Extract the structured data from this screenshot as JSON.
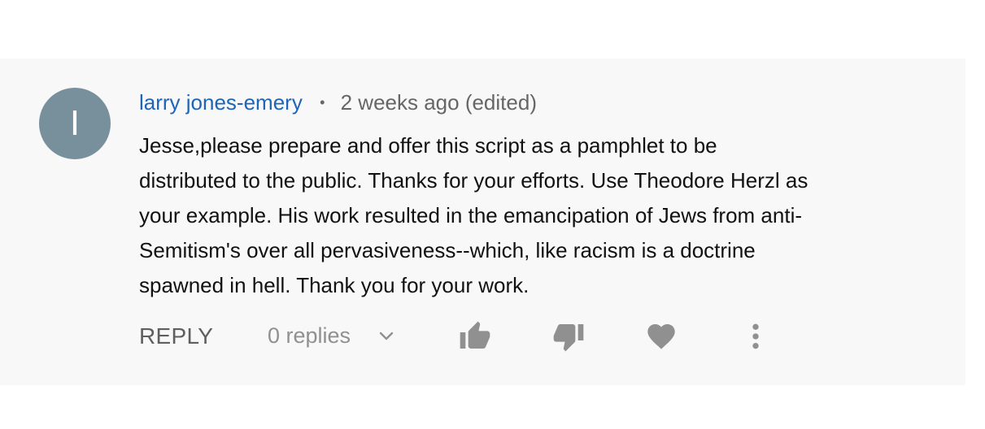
{
  "comment": {
    "avatar_letter": "I",
    "author": "larry jones-emery",
    "separator": "•",
    "time": "2 weeks ago (edited)",
    "text_lines": [
      "Jesse,please prepare and offer this script as a pamphlet to be",
      "distributed to the public. Thanks for your efforts. Use Theodore Herzl as",
      "your example.  His work resulted in the emancipation of Jews from anti-",
      "Semitism's over all pervasiveness--which, like racism is a doctrine",
      "spawned in hell. Thank you for your work."
    ]
  },
  "actions": {
    "reply_label": "REPLY",
    "replies_label": "0 replies"
  },
  "colors": {
    "avatar_bg": "#78909c",
    "author_link": "#1e64b9",
    "card_bg": "#f8f8f8",
    "icon": "#909090"
  },
  "icons": [
    "chevron-down-icon",
    "thumbs-up-icon",
    "thumbs-down-icon",
    "heart-icon",
    "more-vert-icon"
  ]
}
